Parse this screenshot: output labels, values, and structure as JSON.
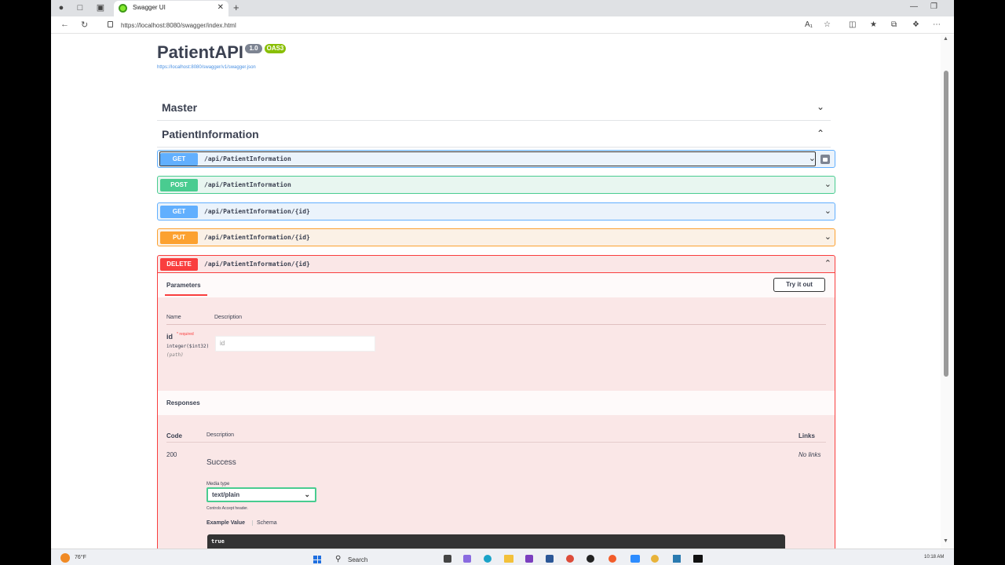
{
  "browser": {
    "tab_title": "Swagger UI",
    "url": "https://localhost:8080/swagger/index.html"
  },
  "api": {
    "title": "PatientAPI",
    "version": "1.0",
    "oas": "OAS3",
    "spec_url": "https://localhost:8080/swagger/v1/swagger.json"
  },
  "tags": [
    {
      "name": "Master",
      "expanded": false
    },
    {
      "name": "PatientInformation",
      "expanded": true
    }
  ],
  "operations": [
    {
      "method": "GET",
      "path": "/api/PatientInformation"
    },
    {
      "method": "POST",
      "path": "/api/PatientInformation"
    },
    {
      "method": "GET",
      "path": "/api/PatientInformation/{id}"
    },
    {
      "method": "PUT",
      "path": "/api/PatientInformation/{id}"
    },
    {
      "method": "DELETE",
      "path": "/api/PatientInformation/{id}"
    }
  ],
  "delete_op": {
    "parameters_title": "Parameters",
    "try_label": "Try it out",
    "col_name": "Name",
    "col_description": "Description",
    "param_name": "id",
    "param_required": "* required",
    "param_type": "integer($int32)",
    "param_in": "(path)",
    "param_placeholder": "id",
    "responses_title": "Responses",
    "col_code": "Code",
    "col_resp_description": "Description",
    "col_links": "Links",
    "resp_code": "200",
    "resp_desc": "Success",
    "no_links": "No links",
    "media_type_label": "Media type",
    "media_type_value": "text/plain",
    "media_note": "Controls Accept header.",
    "example_value_tab": "Example Value",
    "schema_tab": "Schema",
    "example_body": "true"
  },
  "taskbar": {
    "weather": "76°F",
    "search": "Search",
    "time": "10:18 AM"
  },
  "icons": {
    "tag_collapsed": "chevron-down-icon",
    "tag_expanded": "chevron-up-icon"
  }
}
